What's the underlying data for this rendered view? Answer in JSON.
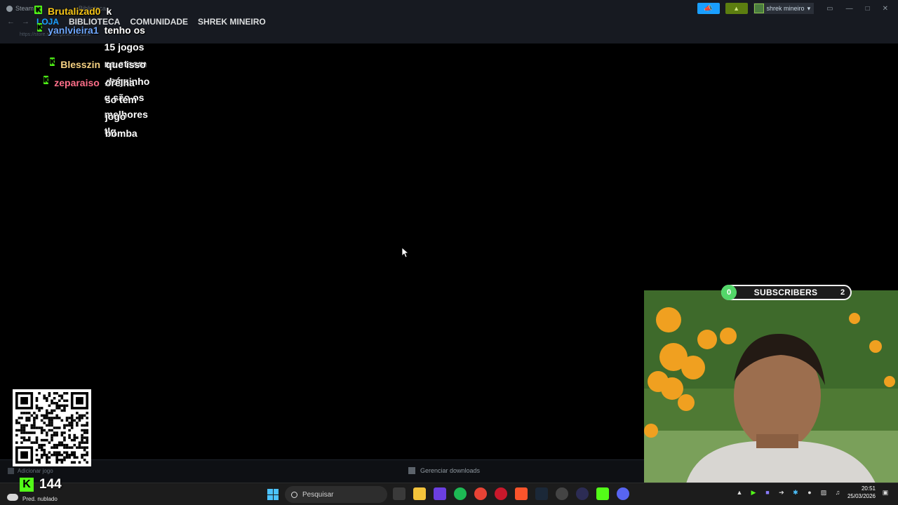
{
  "steam": {
    "window_title": "Steam",
    "title_faded": "Biblioteca",
    "nav": [
      "LOJA",
      "BIBLIOTECA",
      "COMUNIDADE",
      "SHREK MINEIRO"
    ],
    "url": "https://store.steampowered.com/",
    "username": "shrek mineiro",
    "add_game": "Adicionar jogo",
    "downloads": "Gerenciar downloads"
  },
  "chat": [
    {
      "user": "Brutalizad0",
      "text": "k",
      "color": "#f5c518"
    },
    {
      "user": "yanlvieira1",
      "text": "tenho os 15 jogos na steam , só q são os melhores tlg",
      "color": "#6fa8ff"
    },
    {
      "user": "Blesszin",
      "text": "que isso dogzinho",
      "color": "#f5d182"
    },
    {
      "user": "zeparaiso",
      "text": "orelha so tem jogo bomba",
      "color": "#ff6f8a"
    }
  ],
  "chat_lines": {
    "line1": "tenho os 15 jogos na steam , só",
    "line2": "q são os melhores tlg"
  },
  "subs_widget": {
    "left": "0",
    "label": "SUBSCRIBERS",
    "right": "2"
  },
  "viewers": {
    "count": "144"
  },
  "taskbar": {
    "weather": "Pred. nublado",
    "search_placeholder": "Pesquisar",
    "time": "20:51",
    "date": "25/03/2026"
  },
  "colors": {
    "kick_green": "#53fc18",
    "steam_blue": "#1a9fff",
    "taskbar": "#1c1c1c"
  }
}
